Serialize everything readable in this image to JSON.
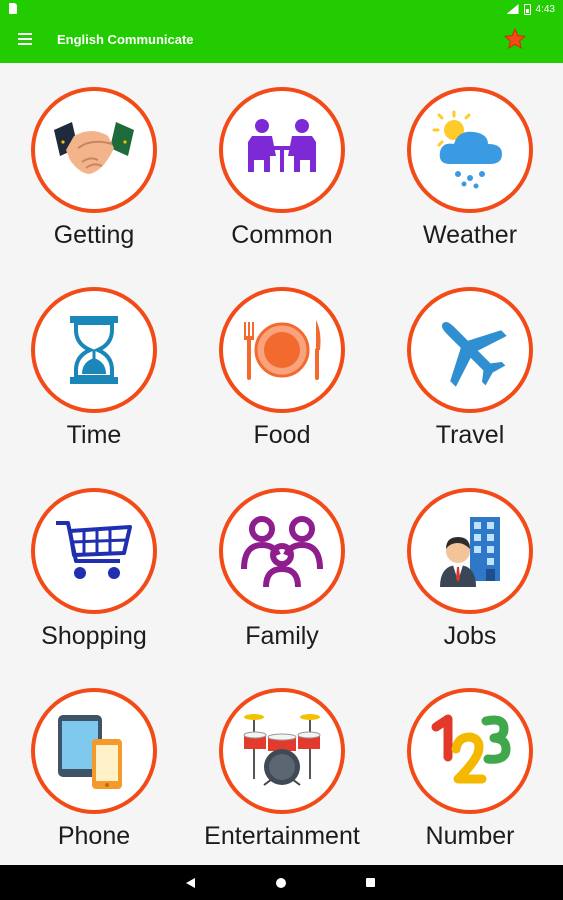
{
  "status_bar": {
    "time": "4:43"
  },
  "app_bar": {
    "title": "English Communicate",
    "accent_color": "#22cc00"
  },
  "ring_color": "#f24b18",
  "categories": [
    {
      "label": "Getting",
      "icon": "handshake-icon"
    },
    {
      "label": "Common",
      "icon": "conversation-icon"
    },
    {
      "label": "Weather",
      "icon": "weather-cloud-icon"
    },
    {
      "label": "Time",
      "icon": "hourglass-icon"
    },
    {
      "label": "Food",
      "icon": "plate-cutlery-icon"
    },
    {
      "label": "Travel",
      "icon": "airplane-icon"
    },
    {
      "label": "Shopping",
      "icon": "shopping-cart-icon"
    },
    {
      "label": "Family",
      "icon": "family-icon"
    },
    {
      "label": "Jobs",
      "icon": "businessman-icon"
    },
    {
      "label": "Phone",
      "icon": "tablet-phone-icon"
    },
    {
      "label": "Entertainment",
      "icon": "drum-kit-icon"
    },
    {
      "label": "Number",
      "icon": "numbers-123-icon"
    }
  ]
}
